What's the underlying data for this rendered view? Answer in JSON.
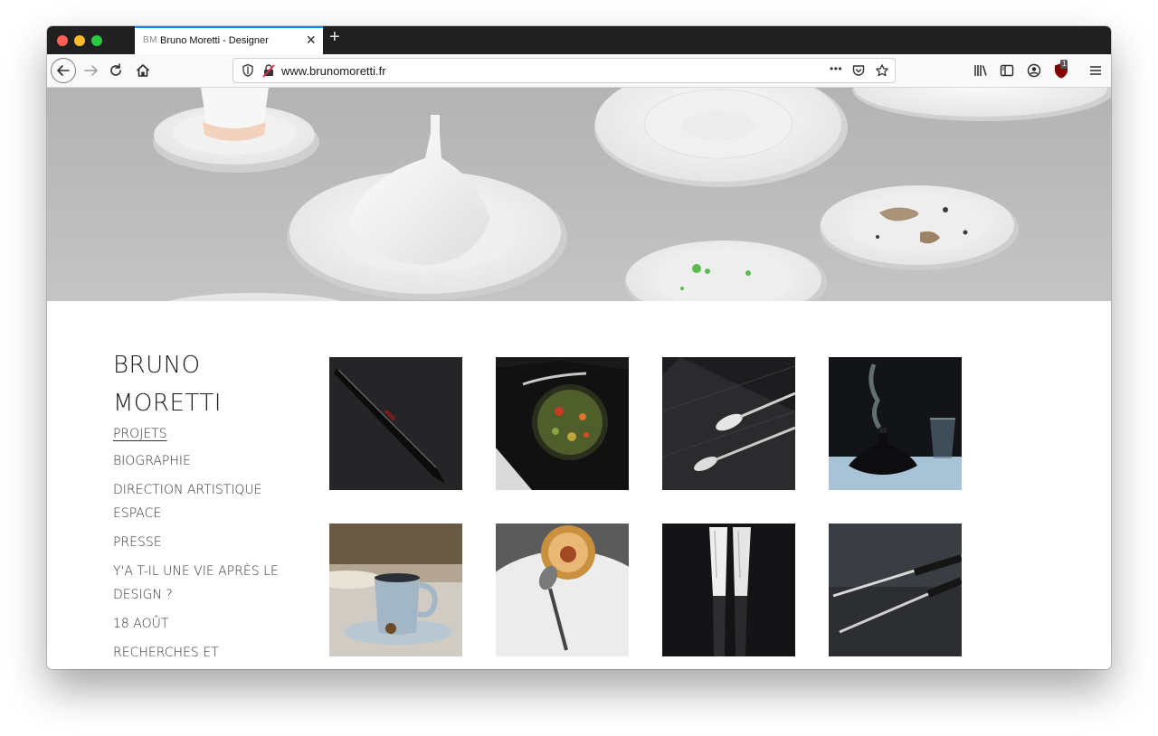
{
  "browser": {
    "tab": {
      "favicon": "BM",
      "title": "Bruno Moretti - Designer",
      "close": "×"
    },
    "new_tab": "+",
    "url": "www.brunomoretti.fr",
    "page_actions": "•••",
    "icons": [
      "back-arrow-icon",
      "forward-arrow-icon",
      "reload-icon",
      "home-icon",
      "shield-icon",
      "insecure-lock-icon",
      "pocket-icon",
      "bookmark-star-icon",
      "library-icon",
      "sidebar-icon",
      "account-icon",
      "ublock-icon",
      "menu-icon"
    ],
    "extension_badge": "1"
  },
  "site": {
    "brand": "BRUNO MORETTI",
    "nav": [
      {
        "label": "PROJETS",
        "active": true
      },
      {
        "label": "BIOGRAPHIE"
      },
      {
        "label": "DIRECTION ARTISTIQUE ESPACE"
      },
      {
        "label": "PRESSE"
      },
      {
        "label": "Y'A T-IL UNE VIE APRÈS LE DESIGN ?"
      },
      {
        "label": "18 AOÛT"
      },
      {
        "label": "RECHERCHES ET"
      }
    ],
    "projects": [
      "black-knife",
      "plated-dish",
      "spoons-on-carbon",
      "black-diffuser",
      "blue-cup",
      "spoon-dessert",
      "white-chopsticks",
      "metal-chopsticks"
    ]
  },
  "colors": {
    "accent": "#0a84ff",
    "tab_bar": "#202020",
    "text": "#1a1a1a"
  }
}
